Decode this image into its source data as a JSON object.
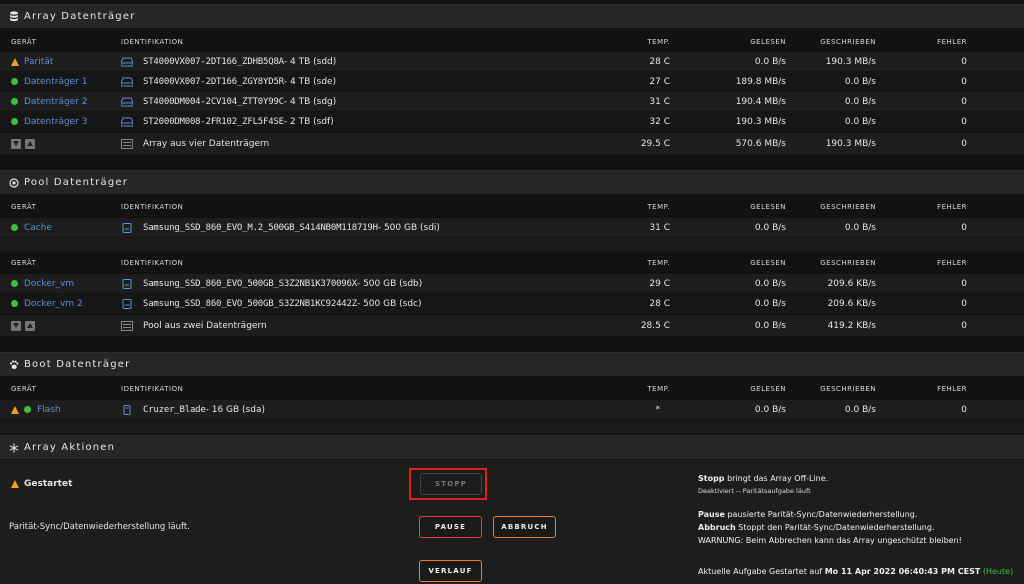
{
  "array": {
    "title": "Array Datenträger",
    "headers": {
      "dev": "GERÄT",
      "id": "IDENTIFIKATION",
      "temp": "TEMP.",
      "read": "GELESEN",
      "write": "GESCHRIEBEN",
      "err": "FEHLER"
    },
    "rows": [
      {
        "dev": "Parität",
        "status": "warning",
        "id": "ST4000VX007-2DT166_ZDHB5Q8A",
        "size": " - 4 TB (sdd)",
        "temp": "28 C",
        "read": "0.0 B/s",
        "write": "190.3 MB/s",
        "err": "0"
      },
      {
        "dev": "Datenträger 1",
        "status": "ok",
        "id": "ST4000VX007-2DT166_ZGY8YD5R",
        "size": " - 4 TB (sde)",
        "temp": "27 C",
        "read": "189.8 MB/s",
        "write": "0.0 B/s",
        "err": "0"
      },
      {
        "dev": "Datenträger 2",
        "status": "ok",
        "id": "ST4000DM004-2CV104_ZTT0Y99C",
        "size": " - 4 TB (sdg)",
        "temp": "31 C",
        "read": "190.4 MB/s",
        "write": "0.0 B/s",
        "err": "0"
      },
      {
        "dev": "Datenträger 3",
        "status": "ok",
        "id": "ST2000DM008-2FR102_ZFL5F4SE",
        "size": " - 2 TB (sdf)",
        "temp": "32 C",
        "read": "190.3 MB/s",
        "write": "0.0 B/s",
        "err": "0"
      }
    ],
    "summary": {
      "id": "Array aus vier Datenträgern",
      "temp": "29.5 C",
      "read": "570.6 MB/s",
      "write": "190.3 MB/s",
      "err": "0"
    }
  },
  "pool": {
    "title": "Pool Datenträger",
    "headers": {
      "dev": "GERÄT",
      "id": "IDENTIFIKATION",
      "temp": "TEMP.",
      "read": "GELESEN",
      "write": "GESCHRIEBEN",
      "err": "FEHLER"
    },
    "cache": {
      "dev": "Cache",
      "id": "Samsung_SSD_860_EVO_M.2_500GB_S414NB0M118719H",
      "size": " - 500 GB (sdi)",
      "temp": "31 C",
      "read": "0.0 B/s",
      "write": "0.0 B/s",
      "err": "0"
    },
    "rows": [
      {
        "dev": "Docker_vm",
        "id": "Samsung_SSD_860_EVO_500GB_S3Z2NB1K370096X",
        "size": " - 500 GB (sdb)",
        "temp": "29 C",
        "read": "0.0 B/s",
        "write": "209.6 KB/s",
        "err": "0"
      },
      {
        "dev": "Docker_vm 2",
        "id": "Samsung_SSD_860_EVO_500GB_S3Z2NB1KC92442Z",
        "size": " - 500 GB (sdc)",
        "temp": "28 C",
        "read": "0.0 B/s",
        "write": "209.6 KB/s",
        "err": "0"
      }
    ],
    "summary": {
      "id": "Pool aus zwei Datenträgern",
      "temp": "28.5 C",
      "read": "0.0 B/s",
      "write": "419.2 KB/s",
      "err": "0"
    }
  },
  "boot": {
    "title": "Boot Datenträger",
    "headers": {
      "dev": "GERÄT",
      "id": "IDENTIFIKATION",
      "temp": "TEMP.",
      "read": "GELESEN",
      "write": "GESCHRIEBEN",
      "err": "FEHLER"
    },
    "row": {
      "dev": "Flash",
      "id": "Cruzer_Blade",
      "size": " - 16 GB (sda)",
      "temp": "*",
      "read": "0.0 B/s",
      "write": "0.0 B/s",
      "err": "0"
    }
  },
  "actions": {
    "title": "Array Aktionen",
    "state": "Gestartet",
    "sync_text": "Parität-Sync/Datenwiederherstellung läuft.",
    "buttons": {
      "stop": "STOPP",
      "pause": "PAUSE",
      "cancel": "ABBRUCH",
      "history": "VERLAUF"
    },
    "stop_help": {
      "bold": "Stopp",
      "text": " bringt das Array Off-Line.",
      "sub": "Deaktiviert -- Paritätsaufgabe läuft"
    },
    "pause_help": {
      "bold": "Pause",
      "text": " pausierte Parität-Sync/Datenwiederherstellung."
    },
    "cancel_help": {
      "bold": "Abbruch",
      "text": " Stoppt den Parität-Sync/Datenwiederherstellung."
    },
    "warning": "WARNUNG: Beim Abbrechen kann das Array ungeschützt bleiben!",
    "task": {
      "prefix": "Aktuelle Aufgabe Gestartet auf ",
      "date": "Mo 11 Apr 2022 06:40:43 PM CEST",
      "today": "(Heute)"
    }
  },
  "colors": {
    "accent": "#e8802a",
    "ok": "#3bc43b",
    "warn": "#f0a020",
    "link": "#5b8fd6",
    "highlight": "#e02020"
  }
}
